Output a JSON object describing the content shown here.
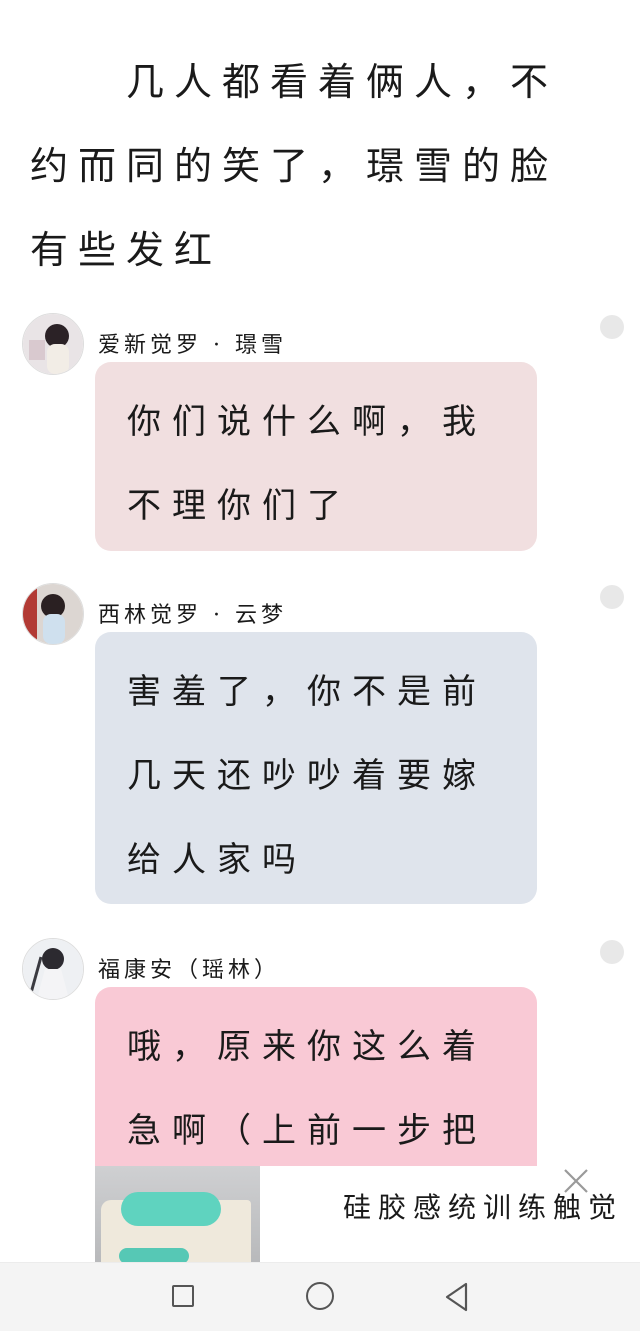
{
  "narration": "几人都看着俩人，不约而同的笑了，璟雪的脸有些发红",
  "messages": [
    {
      "sender": "爱新觉罗 · 璟雪",
      "text": "你们说什么啊，我不理你们了",
      "bubble_color": "#f1dfe0"
    },
    {
      "sender": "西林觉罗 · 云梦",
      "text": "害羞了，你不是前几天还吵吵着要嫁给人家吗",
      "bubble_color": "#dfe4ec"
    },
    {
      "sender": "福康安（瑶林）",
      "text": "哦，原来你这么着急啊（上前一步把",
      "bubble_color": "#f9c9d5"
    }
  ],
  "ad": {
    "title": "硅胶感统训练触觉",
    "close_icon": "close-icon"
  },
  "navbar": {
    "recent_icon": "square-icon",
    "home_icon": "circle-icon",
    "back_icon": "triangle-back-icon"
  }
}
